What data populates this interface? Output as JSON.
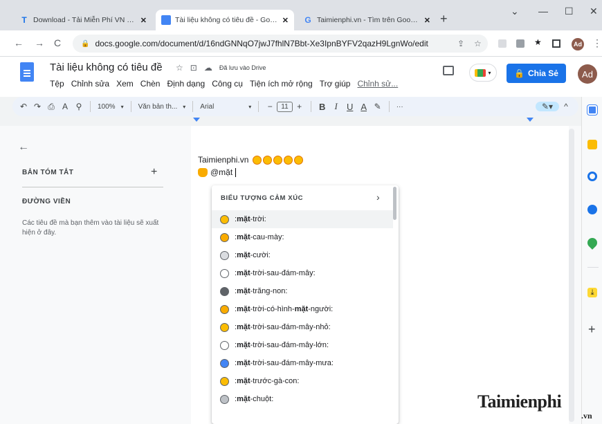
{
  "browser": {
    "tabs": [
      {
        "label": "Download - Tải Miễn Phí VN - Ph",
        "icon": "taimienphi-t-icon",
        "color": "#1a73e8"
      },
      {
        "label": "Tài liệu không có tiêu đề - Googl",
        "icon": "docs-icon",
        "color": "#4285f4"
      },
      {
        "label": "Taimienphi.vn - Tìm trên Google",
        "icon": "google-g-icon",
        "color": "#4285f4"
      }
    ],
    "url": "docs.google.com/document/d/16ndGNNqO7jwJ7fhlN7Bbt-Xe3IpnBYFV2qazH9LgnWo/edit",
    "avatar_initials": "Ad"
  },
  "docs": {
    "title": "Tài liệu không có tiêu đề",
    "saved_status": "Đã lưu vào Drive",
    "menu": [
      "Tệp",
      "Chỉnh sửa",
      "Xem",
      "Chèn",
      "Định dạng",
      "Công cụ",
      "Tiện ích mở rộng",
      "Trợ giúp",
      "Chỉnh sử..."
    ],
    "share_label": "Chia Sẻ",
    "avatar_initials": "Ad"
  },
  "format_toolbar": {
    "zoom": "100%",
    "style": "Văn bản th...",
    "font": "Arial",
    "font_size": "11",
    "more": "···"
  },
  "outline": {
    "summary_title": "BẢN TÓM TẮT",
    "outline_title": "ĐƯỜNG VIỀN",
    "note": "Các tiêu đề mà bạn thêm vào tài liệu sẽ xuất hiện ở đây."
  },
  "document": {
    "line1_text": "Taimienphi.vn",
    "line2_text": "@mặt"
  },
  "emoji_dropdown": {
    "header": "BIỂU TƯỢNG CẢM XÚC",
    "items": [
      {
        "pre": ":",
        "bold": "mặt",
        "post": "-trời:",
        "icon": "sun-face-icon",
        "color": "#fbbc04"
      },
      {
        "pre": ":",
        "bold": "mặt",
        "post": "-cau-mày:",
        "icon": "frowning-face-icon",
        "color": "#f9ab00"
      },
      {
        "pre": ":",
        "bold": "mặt",
        "post": "-cười:",
        "icon": "smiling-face-icon",
        "color": "#dadce0"
      },
      {
        "pre": ":",
        "bold": "mặt",
        "post": "-trời-sau-đám-mây:",
        "icon": "sun-behind-cloud-icon",
        "color": "#ffffff"
      },
      {
        "pre": ":",
        "bold": "mặt",
        "post": "-trăng-non:",
        "icon": "new-moon-face-icon",
        "color": "#5f6368"
      },
      {
        "pre": ":",
        "bold": "mặt",
        "post": "-trời-có-hình-",
        "bold2": "mặt",
        "post2": "-người:",
        "icon": "sun-with-face-icon",
        "color": "#f9ab00"
      },
      {
        "pre": ":",
        "bold": "mặt",
        "post": "-trời-sau-đám-mây-nhỏ:",
        "icon": "sun-small-cloud-icon",
        "color": "#fbbc04"
      },
      {
        "pre": ":",
        "bold": "mặt",
        "post": "-trời-sau-đám-mây-lớn:",
        "icon": "sun-large-cloud-icon",
        "color": "#ffffff"
      },
      {
        "pre": ":",
        "bold": "mặt",
        "post": "-trời-sau-đám-mây-mưa:",
        "icon": "sun-rain-cloud-icon",
        "color": "#4285f4"
      },
      {
        "pre": ":",
        "bold": "mặt",
        "post": "-trước-gà-con:",
        "icon": "hatching-chick-icon",
        "color": "#fbbc04"
      },
      {
        "pre": ":",
        "bold": "mặt",
        "post": "-chuột:",
        "icon": "mouse-face-icon",
        "color": "#bdc1c6"
      }
    ]
  },
  "watermark": {
    "text": "Taimienphi",
    "sub": ".vn"
  }
}
